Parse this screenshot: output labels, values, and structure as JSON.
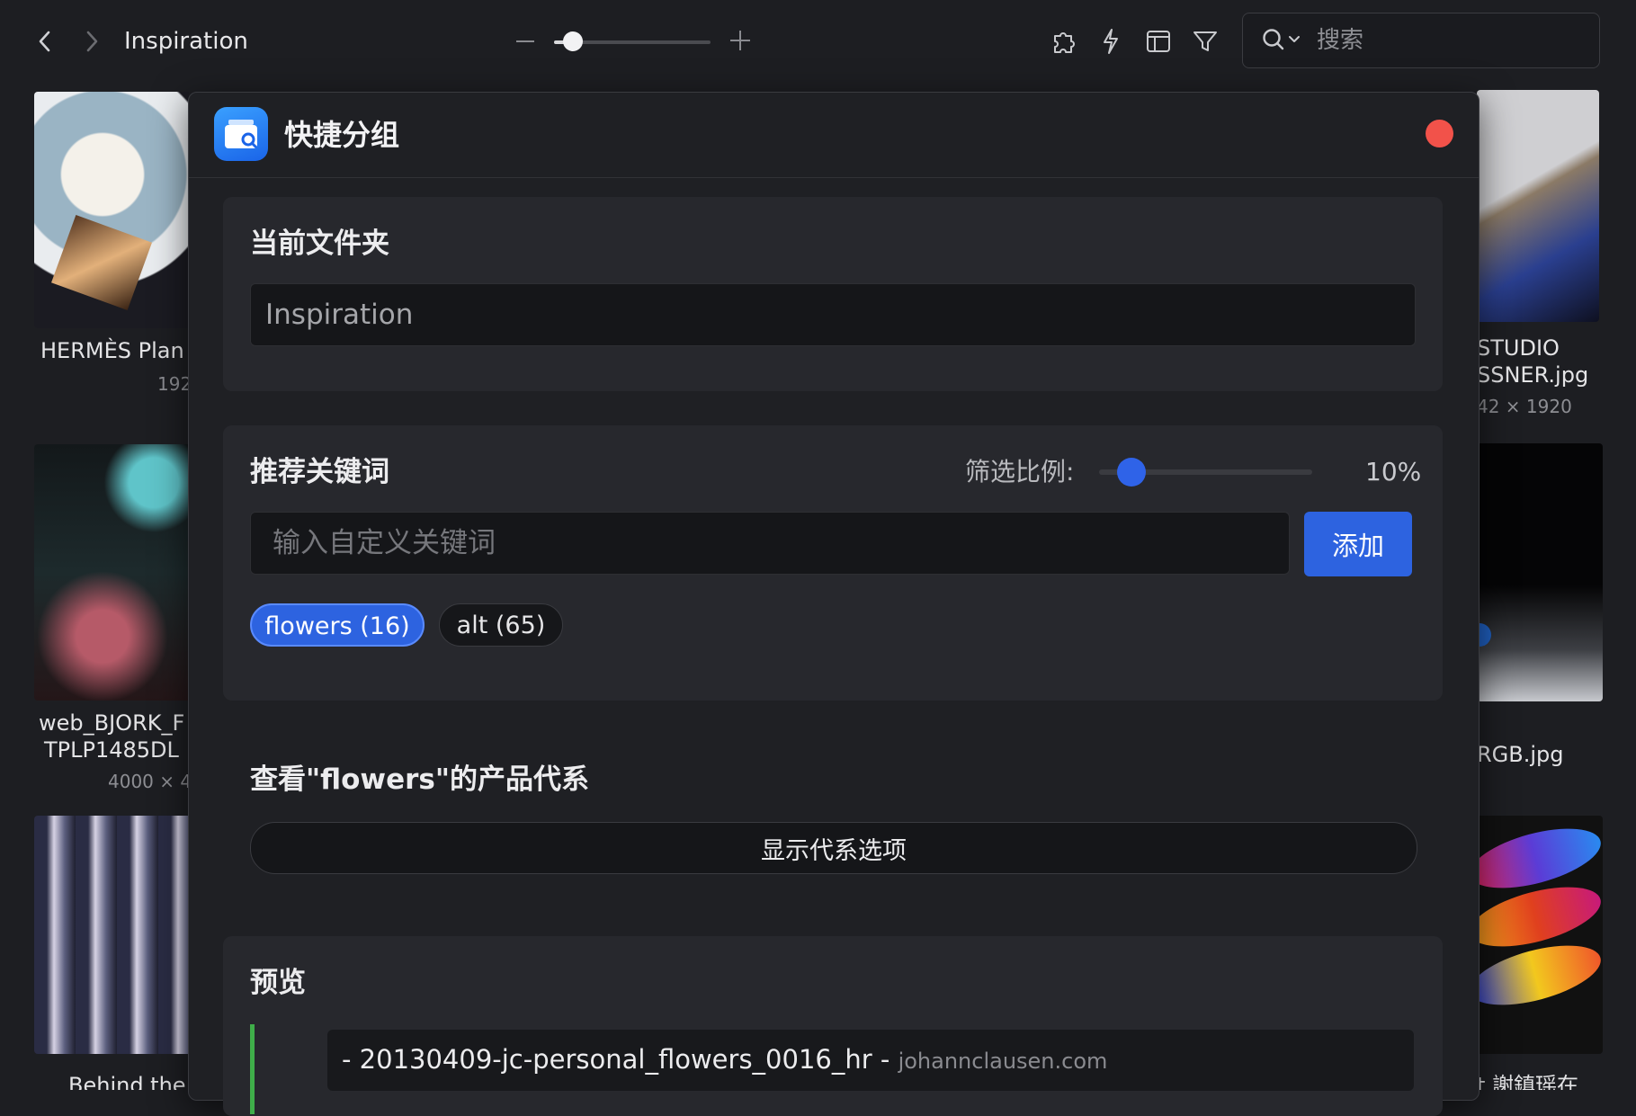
{
  "toolbar": {
    "title": "Inspiration",
    "zoom_level": 0.12,
    "search_placeholder": "搜索",
    "icons": [
      "chevron-left-icon",
      "chevron-right-icon",
      "puzzle-icon",
      "bolt-icon",
      "layout-icon",
      "filter-icon",
      "search-icon"
    ]
  },
  "grid": {
    "left": [
      {
        "caption": "HERMÈS Plan",
        "sub": "192"
      },
      {
        "caption": "web_BJORK_F",
        "caption2": "TPLP1485DL",
        "sub": "4000 × 4"
      },
      {
        "caption": "Behind the"
      }
    ],
    "right": [
      {
        "caption": "STUDIO",
        "caption2": "SSNER.jpg",
        "sub": "42 × 1920"
      },
      {
        "caption": "RGB.jpg"
      },
      {
        "caption": "t 謝鎮瑶在"
      }
    ]
  },
  "dialog": {
    "title": "快捷分组",
    "current_folder": {
      "title": "当前文件夹",
      "value": "Inspiration"
    },
    "keywords": {
      "title": "推荐关键词",
      "ratio_label": "筛选比例:",
      "ratio_value": "10%",
      "ratio_fraction": 0.1,
      "input_placeholder": "输入自定义关键词",
      "add_label": "添加",
      "chips": [
        {
          "label": "flowers (16)",
          "active": true
        },
        {
          "label": "alt (65)",
          "active": false
        }
      ]
    },
    "lineage": {
      "title": "查看\"flowers\"的产品代系",
      "button_label": "显示代系选项"
    },
    "preview": {
      "title": "预览",
      "items": [
        {
          "name": "- 20130409-jc-personal_flowers_0016_hr -",
          "source": "johannclausen.com"
        }
      ]
    }
  },
  "colors": {
    "accent": "#2d63e0",
    "close": "#f2524a",
    "preview_bar": "#3fae49",
    "background": "#1d1e22"
  }
}
